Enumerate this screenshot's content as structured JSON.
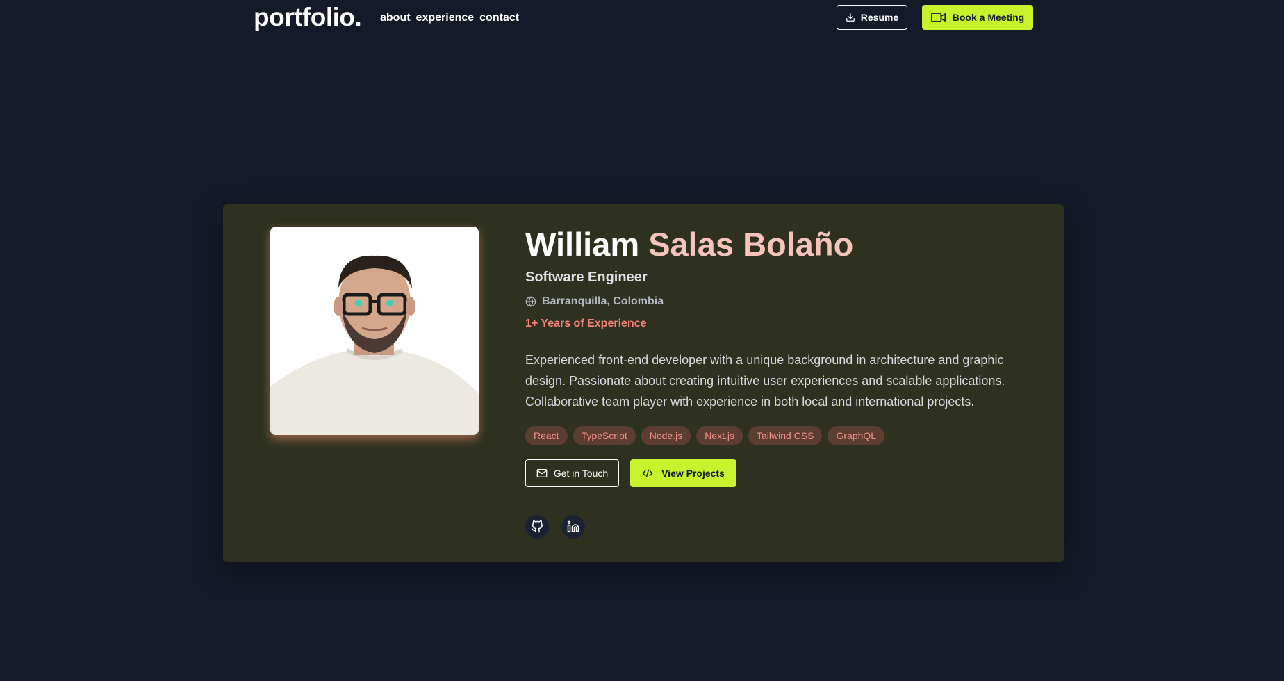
{
  "nav": {
    "logo": "portfolio.",
    "links": [
      "about",
      "experience",
      "contact"
    ],
    "resume_label": "Resume",
    "meeting_label": "Book a Meeting"
  },
  "profile": {
    "first_name": "William",
    "last_name": "Salas Bolaño",
    "role": "Software Engineer",
    "location": "Barranquilla, Colombia",
    "experience": "1+ Years of Experience",
    "bio": "Experienced front-end developer with a unique background in architecture and graphic design. Passionate about creating intuitive user experiences and scalable applications. Collaborative team player with experience in both local and international projects.",
    "tags": [
      "React",
      "TypeScript",
      "Node.js",
      "Next.js",
      "Tailwind CSS",
      "GraphQL"
    ],
    "actions": {
      "touch_label": "Get in Touch",
      "projects_label": "View Projects"
    },
    "socials": [
      "github-icon",
      "linkedin-icon"
    ]
  },
  "colors": {
    "background": "#141a29",
    "card": "#2e311f",
    "accent": "#c8f22c",
    "name_highlight": "#f7c3bb",
    "experience": "#f5847a",
    "tag_bg": "#5c3d31",
    "tag_text": "#f5918a"
  }
}
